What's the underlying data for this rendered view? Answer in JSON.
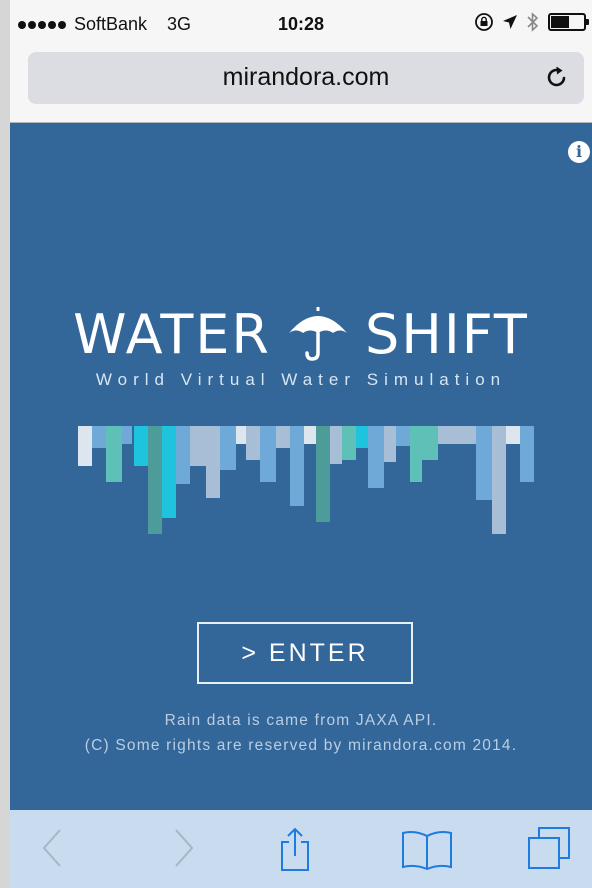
{
  "status_bar": {
    "carrier": "SoftBank",
    "network": "3G",
    "time": "10:28",
    "battery_level": 0.6,
    "icons": [
      "signal-dots-icon",
      "rotation-lock-icon",
      "location-arrow-icon",
      "bluetooth-icon",
      "battery-icon"
    ]
  },
  "browser": {
    "url": "mirandora.com",
    "reload_icon": "reload-icon"
  },
  "page": {
    "background": "#336699",
    "logo": {
      "word_left": "WATER",
      "word_right": "SHIFT",
      "icon": "umbrella-icon"
    },
    "tagline": "World Virtual Water Simulation",
    "enter_label": "> ENTER",
    "credit_line_1": "Rain data is came from JAXA API.",
    "credit_line_2": "(C) Some rights are reserved by mirandora.com 2014.",
    "info_icon": "info-icon"
  },
  "toolbar": {
    "items": [
      "back-icon",
      "forward-icon",
      "share-icon",
      "bookmarks-icon",
      "tabs-icon"
    ],
    "color": "#c9dcef"
  }
}
